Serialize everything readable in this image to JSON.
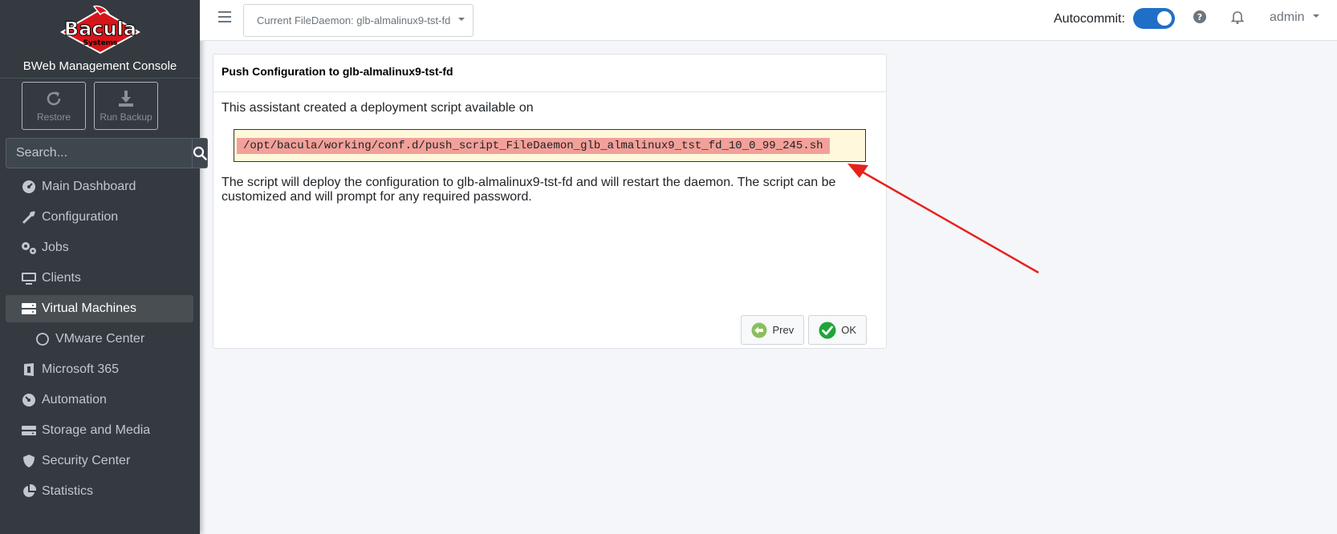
{
  "brand": {
    "logo_text": "Bacula",
    "logo_sub": "Systems",
    "console_title": "BWeb Management Console"
  },
  "actions": {
    "restore_label": "Restore",
    "run_backup_label": "Run Backup"
  },
  "search": {
    "placeholder": "Search..."
  },
  "sidebar": {
    "items": [
      {
        "label": "Main Dashboard",
        "icon": "dashboard-icon"
      },
      {
        "label": "Configuration",
        "icon": "tools-icon"
      },
      {
        "label": "Jobs",
        "icon": "gears-icon"
      },
      {
        "label": "Clients",
        "icon": "desktop-icon"
      },
      {
        "label": "Virtual Machines",
        "icon": "server-icon",
        "active": true
      },
      {
        "label": "VMware Center",
        "icon": "circle-icon"
      },
      {
        "label": "Microsoft 365",
        "icon": "office-icon"
      },
      {
        "label": "Automation",
        "icon": "automation-icon"
      },
      {
        "label": "Storage and Media",
        "icon": "storage-icon"
      },
      {
        "label": "Security Center",
        "icon": "shield-icon"
      },
      {
        "label": "Statistics",
        "icon": "pie-chart-icon"
      }
    ]
  },
  "topbar": {
    "fd_select": "Current FileDaemon: glb-almalinux9-tst-fd",
    "autocommit_label": "Autocommit:",
    "autocommit_on": true,
    "user": "admin"
  },
  "card": {
    "title": "Push Configuration to glb-almalinux9-tst-fd",
    "intro": "This assistant created a deployment script available on",
    "script_path": "/opt/bacula/working/conf.d/push_script_FileDaemon_glb_almalinux9_tst_fd_10_0_99_245.sh",
    "description": "The script will deploy the configuration to glb-almalinux9-tst-fd and will restart the daemon. The script can be customized and will prompt for any required password.",
    "prev_label": "Prev",
    "ok_label": "OK"
  },
  "colors": {
    "sidebar_bg": "#343a40",
    "accent": "#1f6fc9",
    "annotation_arrow": "#e8201c",
    "script_highlight": "#f2a09a"
  }
}
